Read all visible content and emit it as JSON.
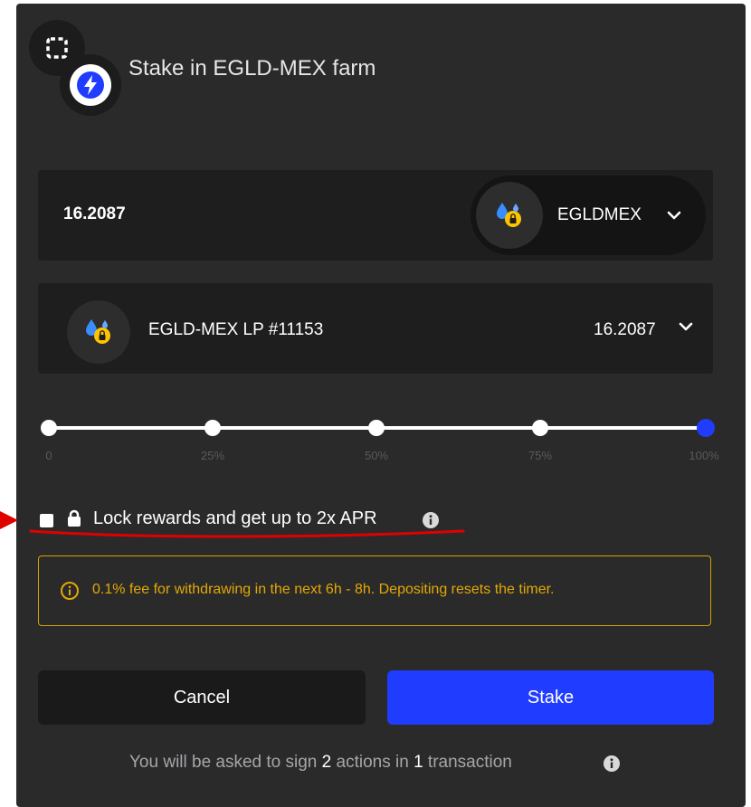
{
  "modal": {
    "title": "Stake in EGLD-MEX farm"
  },
  "amount_input": {
    "value": "16.2087",
    "token_label": "EGLDMEX"
  },
  "lp_selector": {
    "label": "EGLD-MEX LP #11153",
    "amount": "16.2087"
  },
  "slider": {
    "ticks": [
      "0",
      "25%",
      "50%",
      "75%",
      "100%"
    ],
    "value_percent": 100
  },
  "lock": {
    "checked": false,
    "label": "Lock rewards and get up to 2x APR"
  },
  "warning": {
    "text": "0.1% fee for withdrawing in the next 6h - 8h. Depositing resets the timer."
  },
  "buttons": {
    "cancel": "Cancel",
    "stake": "Stake"
  },
  "footer": {
    "prefix": "You will be asked to sign ",
    "actions_count": "2",
    "middle": " actions in ",
    "tx_count": "1",
    "suffix": " transaction"
  },
  "colors": {
    "accent": "#1f3cff",
    "warning": "#e2a804",
    "annotation": "#e00000",
    "background": "#2a2a2b"
  }
}
